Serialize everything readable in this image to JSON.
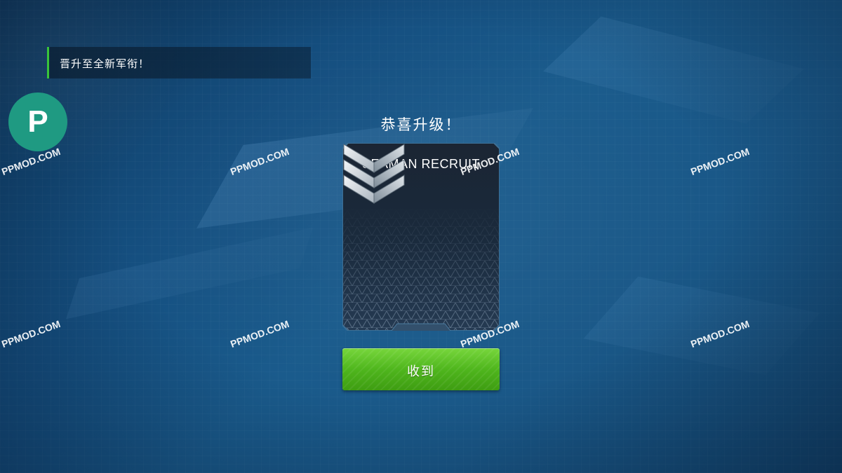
{
  "notification": {
    "text": "晋升至全新军衔！"
  },
  "logo": {
    "letter": "P"
  },
  "promotion": {
    "heading": "恭喜升级！",
    "rank_name": "SEAMAN RECRUIT",
    "rank_icon": "three-chevrons-icon"
  },
  "actions": {
    "collect_label": "收到"
  },
  "watermark": {
    "text": "PPMOD.COM"
  },
  "colors": {
    "accent_green": "#4fb61d",
    "notification_bar": "#39c43a",
    "logo_teal": "#1f9a82",
    "card_bg": "#1a2a3c"
  }
}
